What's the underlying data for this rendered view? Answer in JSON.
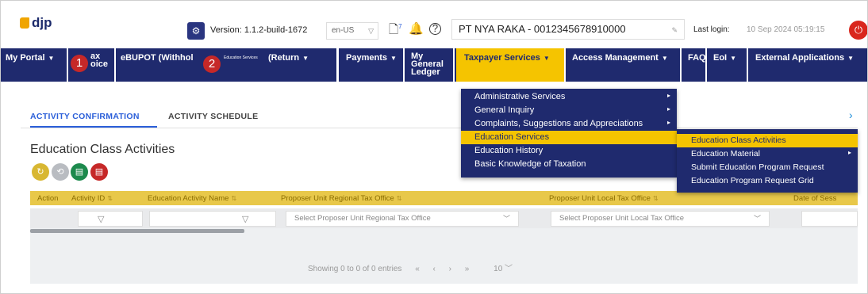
{
  "header": {
    "logo_text": "djp",
    "version_label": "Version:",
    "version_value": "1.1.2-build-1672",
    "language": "en-US",
    "notification_count": "7",
    "company": "PT NYA RAKA - 0012345678910000",
    "last_login_label": "Last login:",
    "last_login_value": "10 Sep 2024 05:19:15"
  },
  "nav": {
    "items": [
      {
        "label": "My Portal"
      },
      {
        "label": "Tax Invoice",
        "visible": "ax\noice"
      },
      {
        "label": "eBUPOT (Withhol",
        "overlay": "Education Services"
      },
      {
        "label": "Return"
      },
      {
        "label": "Payments"
      },
      {
        "label": "My General Ledger",
        "lines": [
          "My",
          "General",
          "Ledger"
        ]
      },
      {
        "label": "Taxpayer Services"
      },
      {
        "label": "Access Management"
      },
      {
        "label": "FAQ"
      },
      {
        "label": "EoI"
      },
      {
        "label": "External Applications"
      }
    ],
    "badge1": "1",
    "badge2": "2"
  },
  "menu_taxpayer_services": [
    {
      "label": "Administrative Services",
      "submenu": true
    },
    {
      "label": "General Inquiry",
      "submenu": true
    },
    {
      "label": "Complaints, Suggestions and Appreciations",
      "submenu": true
    },
    {
      "label": "Education Services",
      "submenu": false,
      "selected": true
    },
    {
      "label": "Education History",
      "submenu": false
    },
    {
      "label": "Basic Knowledge of Taxation",
      "submenu": false
    }
  ],
  "menu_education_services": [
    {
      "label": "Education Class Activities",
      "selected": true
    },
    {
      "label": "Education Material",
      "submenu": true
    },
    {
      "label": "Submit Education Program Request"
    },
    {
      "label": "Education Program Request Grid"
    }
  ],
  "tabs": [
    {
      "label": "ACTIVITY CONFIRMATION",
      "active": true
    },
    {
      "label": "ACTIVITY SCHEDULE",
      "active": false
    }
  ],
  "page_title": "Education Class Activities",
  "table": {
    "columns": [
      {
        "label": "Action",
        "sortable": false
      },
      {
        "label": "Activity ID",
        "sortable": true
      },
      {
        "label": "Education Activity Name",
        "sortable": true
      },
      {
        "label": "Proposer Unit Regional Tax Office",
        "sortable": true
      },
      {
        "label": "Proposer Unit Local Tax Office",
        "sortable": true
      },
      {
        "label": "Date of Sess",
        "sortable": false
      }
    ],
    "filter_regional_placeholder": "Select Proposer Unit Regional Tax Office",
    "filter_local_placeholder": "Select Proposer Unit Local Tax Office",
    "paging_text": "Showing 0 to 0 of 0 entries",
    "page_size": "10"
  },
  "colors": {
    "nav_bg": "#1f2a6e",
    "accent_yellow": "#f5c400",
    "link_blue": "#2b5fd9",
    "badge_red": "#c62828"
  }
}
